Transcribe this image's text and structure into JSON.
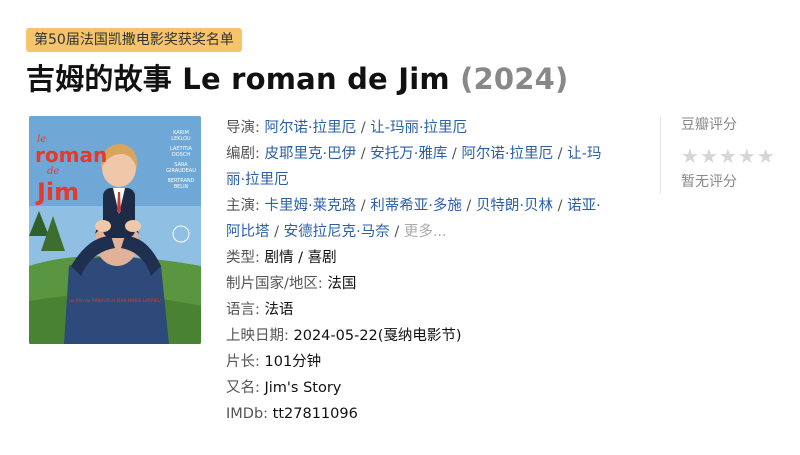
{
  "award_tag": "第50届法国凯撒电影奖获奖名单",
  "title": {
    "name": "吉姆的故事 Le roman de Jim",
    "year": "(2024)"
  },
  "poster": {
    "title_lines": [
      "le",
      "roman",
      "de",
      "Jim"
    ],
    "cast_lines": [
      "KARIM",
      "LEKLOU",
      "LAETITIA",
      "DOSCH",
      "SARA",
      "GIRAUDEAU",
      "BERTRAND",
      "BELIN"
    ],
    "credit_line": "un film de ARNAUD et JEAN-MARIE LARRIEU",
    "colors": {
      "sky": "#7fb4dc",
      "grass": "#4f8a3a",
      "title": "#e53a2b"
    }
  },
  "info": {
    "director": {
      "label": "导演:",
      "people": [
        "阿尔诺·拉里厄",
        "让-玛丽·拉里厄"
      ]
    },
    "writer": {
      "label": "编剧:",
      "people": [
        "皮耶里克·巴伊",
        "安托万·雅库",
        "阿尔诺·拉里厄",
        "让-玛",
        "丽·拉里厄"
      ]
    },
    "cast": {
      "label": "主演:",
      "people": [
        "卡里姆·莱克路",
        "利蒂希亚·多施",
        "贝特朗·贝林",
        "诺亚·",
        "阿比塔",
        "安德拉尼克·马奈"
      ],
      "more": "更多..."
    },
    "genre": {
      "label": "类型:",
      "value": "剧情 / 喜剧"
    },
    "country": {
      "label": "制片国家/地区:",
      "value": "法国"
    },
    "language": {
      "label": "语言:",
      "value": "法语"
    },
    "release": {
      "label": "上映日期:",
      "value": "2024-05-22(戛纳电影节)"
    },
    "runtime": {
      "label": "片长:",
      "value": "101分钟"
    },
    "aka": {
      "label": "又名:",
      "value": "Jim's Story"
    },
    "imdb": {
      "label": "IMDb:",
      "value": "tt27811096"
    }
  },
  "rating": {
    "title": "豆瓣评分",
    "stars_filled": 0,
    "stars_total": 5,
    "no_rating_text": "暂无评分"
  }
}
